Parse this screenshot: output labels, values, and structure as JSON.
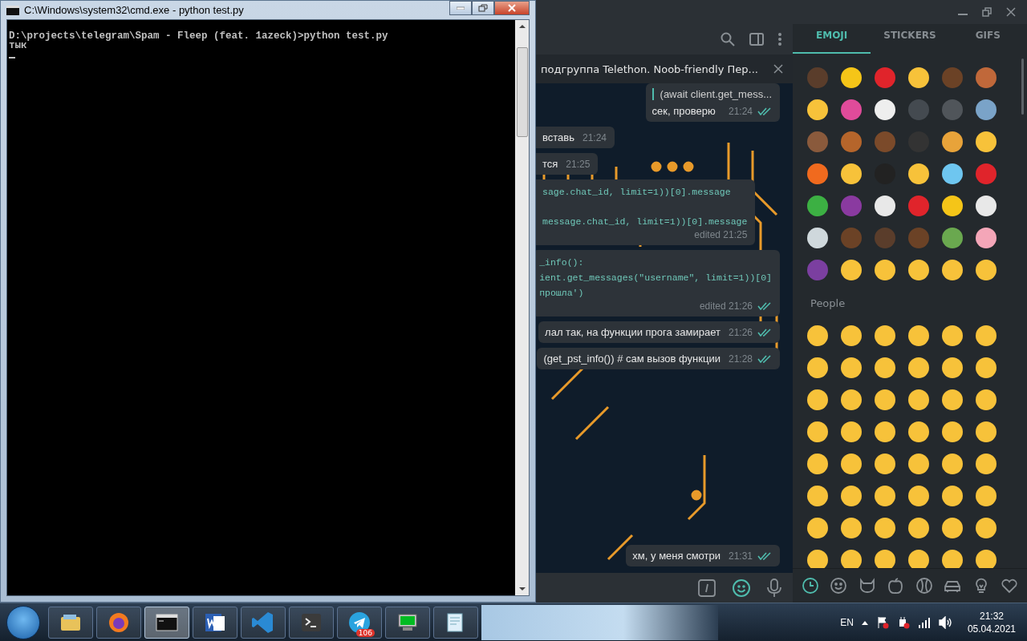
{
  "console_window": {
    "title": "C:\\Windows\\system32\\cmd.exe - python  test.py",
    "lines": [
      "D:\\projects\\telegram\\Spam - Fleep (feat. 1azeck)>python test.py",
      "тык"
    ]
  },
  "chat": {
    "pinned": "подгруппа Telethon. Noob-friendly Пер...",
    "messages": [
      {
        "kind": "text",
        "outgoing": true,
        "reply": "(await client.get_mess...",
        "lines": [
          "сек, проверю"
        ],
        "time": "21:24"
      },
      {
        "kind": "text",
        "outgoing": false,
        "lines": [
          "вставь"
        ],
        "time": "21:24"
      },
      {
        "kind": "text",
        "outgoing": false,
        "lines": [
          "тся"
        ],
        "time": "21:25"
      },
      {
        "kind": "code",
        "outgoing": false,
        "spaced": true,
        "lines": [
          "sage.chat_id, limit=1))[0].message",
          "message.chat_id, limit=1))[0].message"
        ],
        "time": "edited 21:25"
      },
      {
        "kind": "code",
        "outgoing": true,
        "lines": [
          "_info():",
          "ient.get_messages(\"username\", limit=1))[0]",
          "прошла')"
        ],
        "time": "edited 21:26"
      },
      {
        "kind": "text",
        "outgoing": true,
        "lines": [
          "лал так, на функции прога замирает"
        ],
        "time": "21:26"
      },
      {
        "kind": "text",
        "outgoing": true,
        "lines": [
          "(get_pst_info()) # сам вызов функции"
        ],
        "time": "21:28"
      },
      {
        "kind": "text",
        "outgoing": true,
        "lines": [
          "хм, у меня смотри"
        ],
        "time": "21:31"
      }
    ],
    "emoji_active": true
  },
  "emoji_panel": {
    "tabs": [
      {
        "label": "EMOJI",
        "selected": true
      },
      {
        "label": "STICKERS",
        "selected": false
      },
      {
        "label": "GIFS",
        "selected": false
      }
    ],
    "recent": [
      {
        "items": [
          {
            "color": "#5a3d2b"
          },
          {
            "color": "#f5c518"
          },
          {
            "color": "#e0242b"
          },
          {
            "color": "#f7c23a"
          },
          {
            "color": "#6b4226"
          },
          {
            "color": "#c0683a"
          }
        ]
      },
      {
        "items": [
          {
            "color": "#f7c23a"
          },
          {
            "color": "#e04b9a"
          },
          {
            "color": "#eeeeee"
          },
          {
            "color": "#444a50"
          },
          {
            "color": "#50555a"
          },
          {
            "color": "#7aa3c8"
          }
        ]
      },
      {
        "items": [
          {
            "color": "#8a5a3c"
          },
          {
            "color": "#b5652b"
          },
          {
            "color": "#7b4a2a"
          },
          {
            "color": "#333333"
          },
          {
            "color": "#e8a33a"
          },
          {
            "color": "#f7c23a"
          }
        ]
      },
      {
        "items": [
          {
            "color": "#f06a1e"
          },
          {
            "color": "#f7c23a"
          },
          {
            "color": "#222222"
          },
          {
            "color": "#f7c23a"
          },
          {
            "color": "#6ec6f0"
          },
          {
            "color": "#e0242b"
          }
        ]
      },
      {
        "items": [
          {
            "color": "#3cb043"
          },
          {
            "color": "#8a3aa0"
          },
          {
            "color": "#e8e8e8"
          },
          {
            "color": "#e0242b"
          },
          {
            "color": "#f5c518"
          },
          {
            "color": "#e8e8e8"
          }
        ]
      },
      {
        "items": [
          {
            "color": "#cfd8dc"
          },
          {
            "color": "#6b4226"
          },
          {
            "color": "#5a3d2b"
          },
          {
            "color": "#6b4226"
          },
          {
            "color": "#6aa84f"
          },
          {
            "color": "#f4a6b8"
          }
        ]
      },
      {
        "items": [
          {
            "color": "#7b3fa0"
          },
          {
            "color": "#f7c23a"
          },
          {
            "color": "#f7c23a"
          },
          {
            "color": "#f7c23a"
          },
          {
            "color": "#f7c23a"
          },
          {
            "color": "#f7c23a"
          }
        ]
      }
    ],
    "section": "People",
    "people": [
      {
        "items": [
          {
            "color": "#f7c23a"
          },
          {
            "color": "#f7c23a"
          },
          {
            "color": "#f7c23a"
          },
          {
            "color": "#f7c23a"
          },
          {
            "color": "#f7c23a"
          },
          {
            "color": "#f7c23a"
          }
        ]
      },
      {
        "items": [
          {
            "color": "#f7c23a"
          },
          {
            "color": "#f7c23a"
          },
          {
            "color": "#f7c23a"
          },
          {
            "color": "#f7c23a"
          },
          {
            "color": "#f7c23a"
          },
          {
            "color": "#f7c23a"
          }
        ]
      },
      {
        "items": [
          {
            "color": "#f7c23a"
          },
          {
            "color": "#f7c23a"
          },
          {
            "color": "#f7c23a"
          },
          {
            "color": "#f7c23a"
          },
          {
            "color": "#f7c23a"
          },
          {
            "color": "#f7c23a"
          }
        ]
      },
      {
        "items": [
          {
            "color": "#f7c23a"
          },
          {
            "color": "#f7c23a"
          },
          {
            "color": "#f7c23a"
          },
          {
            "color": "#f7c23a"
          },
          {
            "color": "#f7c23a"
          },
          {
            "color": "#f7c23a"
          }
        ]
      },
      {
        "items": [
          {
            "color": "#f7c23a"
          },
          {
            "color": "#f7c23a"
          },
          {
            "color": "#f7c23a"
          },
          {
            "color": "#f7c23a"
          },
          {
            "color": "#f7c23a"
          },
          {
            "color": "#f7c23a"
          }
        ]
      },
      {
        "items": [
          {
            "color": "#f7c23a"
          },
          {
            "color": "#f7c23a"
          },
          {
            "color": "#f7c23a"
          },
          {
            "color": "#f7c23a"
          },
          {
            "color": "#f7c23a"
          },
          {
            "color": "#f7c23a"
          }
        ]
      },
      {
        "items": [
          {
            "color": "#f7c23a"
          },
          {
            "color": "#f7c23a"
          },
          {
            "color": "#f7c23a"
          },
          {
            "color": "#f7c23a"
          },
          {
            "color": "#f7c23a"
          },
          {
            "color": "#f7c23a"
          }
        ]
      },
      {
        "items": [
          {
            "color": "#f7c23a"
          },
          {
            "color": "#f7c23a"
          },
          {
            "color": "#f7c23a"
          },
          {
            "color": "#f7c23a"
          },
          {
            "color": "#f7c23a"
          },
          {
            "color": "#f7c23a"
          }
        ]
      }
    ],
    "categories": [
      {
        "kind": "recent",
        "selected": true
      },
      {
        "kind": "people",
        "selected": false
      },
      {
        "kind": "animals",
        "selected": false
      },
      {
        "kind": "food",
        "selected": false
      },
      {
        "kind": "activity",
        "selected": false
      },
      {
        "kind": "travel",
        "selected": false
      },
      {
        "kind": "objects",
        "selected": false
      },
      {
        "kind": "symbols",
        "selected": false
      }
    ]
  },
  "taskbar": {
    "apps": [
      {
        "kind": "explorer",
        "active": false
      },
      {
        "kind": "firefox",
        "active": false
      },
      {
        "kind": "console",
        "active": true
      },
      {
        "kind": "word",
        "active": false
      },
      {
        "kind": "vscode",
        "active": false
      },
      {
        "kind": "terminal",
        "active": false
      },
      {
        "kind": "telegram",
        "active": false,
        "badge": "106"
      },
      {
        "kind": "monitor",
        "active": false
      },
      {
        "kind": "notepad",
        "active": false
      }
    ],
    "language": "EN",
    "time": "21:32",
    "date": "05.04.2021"
  }
}
